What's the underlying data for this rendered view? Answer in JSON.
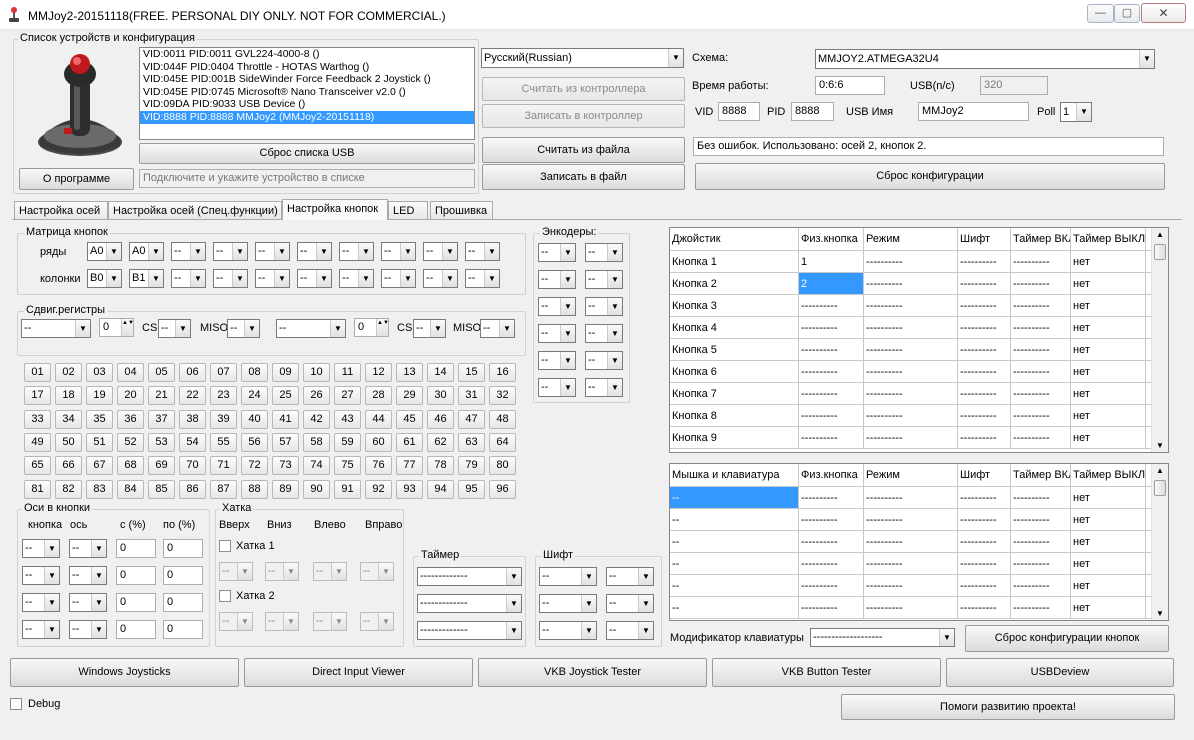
{
  "window": {
    "title": "MMJoy2-20151118(FREE. PERSONAL DIY ONLY. NOT FOR COMMERCIAL.)",
    "min": "—",
    "max": "▢",
    "close": "✕"
  },
  "devices": {
    "group": "Список устройств и конфигурация",
    "items": [
      "VID:0011 PID:0011 GVL224-4000-8 ()",
      "VID:044F PID:0404 Throttle - HOTAS Warthog ()",
      "VID:045E PID:001B SideWinder Force Feedback 2 Joystick ()",
      "VID:045E PID:0745 Microsoft® Nano Transceiver v2.0 ()",
      "VID:09DA PID:9033 USB Device ()",
      "VID:8888 PID:8888 MMJoy2 (MMJoy2-20151118)"
    ],
    "reset_usb": "Сброс списка USB",
    "about": "О программе",
    "hint": "Подключите и укажите устройство в списке"
  },
  "actions": {
    "language": "Русский(Russian)",
    "read_ctrl": "Считать из контроллера",
    "write_ctrl": "Записать в контроллер",
    "read_file": "Считать из файла",
    "write_file": "Записать в файл"
  },
  "config": {
    "scheme_label": "Схема:",
    "scheme": "MMJOY2.ATMEGA32U4",
    "uptime_label": "Время работы:",
    "uptime": "0:6:6",
    "usb_label": "USB(n/c)",
    "usb_val": "320",
    "vid_label": "VID",
    "vid": "8888",
    "pid_label": "PID",
    "pid": "8888",
    "usbname_label": "USB Имя",
    "usbname": "MMJoy2",
    "poll_label": "Poll",
    "poll": "1",
    "status": "Без ошибок. Использовано: осей  2, кнопок  2.",
    "reset_cfg": "Сброс конфигурации"
  },
  "tabs": [
    "Настройка осей",
    "Настройка осей (Спец.функции)",
    "Настройка кнопок",
    "LED",
    "Прошивка"
  ],
  "matrix": {
    "group": "Матрица кнопок",
    "rows_label": "ряды",
    "cols_label": "колонки",
    "row1": "A0",
    "row2": "A0",
    "col1": "B0",
    "col2": "B1",
    "dash": "--"
  },
  "shift_regs": {
    "group": "Сдвиг.регистры",
    "sel": "--",
    "spin": "0",
    "cs": "CS",
    "miso": "MISO",
    "dash": "--"
  },
  "encoders": {
    "group": "Энкодеры:",
    "dash": "--"
  },
  "buttons": [
    "01",
    "02",
    "03",
    "04",
    "05",
    "06",
    "07",
    "08",
    "09",
    "10",
    "11",
    "12",
    "13",
    "14",
    "15",
    "16",
    "17",
    "18",
    "19",
    "20",
    "21",
    "22",
    "23",
    "24",
    "25",
    "26",
    "27",
    "28",
    "29",
    "30",
    "31",
    "32",
    "33",
    "34",
    "35",
    "36",
    "37",
    "38",
    "39",
    "40",
    "41",
    "42",
    "43",
    "44",
    "45",
    "46",
    "47",
    "48",
    "49",
    "50",
    "51",
    "52",
    "53",
    "54",
    "55",
    "56",
    "57",
    "58",
    "59",
    "60",
    "61",
    "62",
    "63",
    "64",
    "65",
    "66",
    "67",
    "68",
    "69",
    "70",
    "71",
    "72",
    "73",
    "74",
    "75",
    "76",
    "77",
    "78",
    "79",
    "80",
    "81",
    "82",
    "83",
    "84",
    "85",
    "86",
    "87",
    "88",
    "89",
    "90",
    "91",
    "92",
    "93",
    "94",
    "95",
    "96"
  ],
  "axes_buttons": {
    "group": "Оси в кнопки",
    "h_btn": "кнопка",
    "h_axis": "ось",
    "h_from": "с (%)",
    "h_to": "по (%)",
    "dash": "--",
    "zero": "0"
  },
  "hat": {
    "group": "Хатка",
    "up": "Вверх",
    "down": "Вниз",
    "left": "Влево",
    "right": "Вправо",
    "hat1": "Хатка 1",
    "hat2": "Хатка 2",
    "dash": "--"
  },
  "timer": {
    "group": "Таймер",
    "dash": "-------------"
  },
  "shift": {
    "group": "Шифт",
    "dash": "--"
  },
  "joystick_table": {
    "headers": [
      "Джойстик",
      "Физ.кнопка",
      "Режим",
      "Шифт",
      "Таймер ВКЛ",
      "Таймер ВЫКЛ"
    ],
    "rows": [
      [
        "Кнопка 1",
        "1",
        "----------",
        "----------",
        "----------",
        "нет"
      ],
      [
        "Кнопка 2",
        "2",
        "----------",
        "----------",
        "----------",
        "нет"
      ],
      [
        "Кнопка 3",
        "----------",
        "----------",
        "----------",
        "----------",
        "нет"
      ],
      [
        "Кнопка 4",
        "----------",
        "----------",
        "----------",
        "----------",
        "нет"
      ],
      [
        "Кнопка 5",
        "----------",
        "----------",
        "----------",
        "----------",
        "нет"
      ],
      [
        "Кнопка 6",
        "----------",
        "----------",
        "----------",
        "----------",
        "нет"
      ],
      [
        "Кнопка 7",
        "----------",
        "----------",
        "----------",
        "----------",
        "нет"
      ],
      [
        "Кнопка 8",
        "----------",
        "----------",
        "----------",
        "----------",
        "нет"
      ],
      [
        "Кнопка 9",
        "----------",
        "----------",
        "----------",
        "----------",
        "нет"
      ]
    ]
  },
  "mouse_table": {
    "headers": [
      "Мышка и клавиатура",
      "Физ.кнопка",
      "Режим",
      "Шифт",
      "Таймер ВКЛ",
      "Таймер ВЫКЛ"
    ],
    "rows": [
      [
        "--",
        "----------",
        "----------",
        "----------",
        "----------",
        "нет"
      ],
      [
        "--",
        "----------",
        "----------",
        "----------",
        "----------",
        "нет"
      ],
      [
        "--",
        "----------",
        "----------",
        "----------",
        "----------",
        "нет"
      ],
      [
        "--",
        "----------",
        "----------",
        "----------",
        "----------",
        "нет"
      ],
      [
        "--",
        "----------",
        "----------",
        "----------",
        "----------",
        "нет"
      ],
      [
        "--",
        "----------",
        "----------",
        "----------",
        "----------",
        "нет"
      ]
    ]
  },
  "modifier": {
    "label": "Модификатор клавиатуры",
    "value": "-------------------",
    "reset_buttons": "Сброс конфигурации кнопок"
  },
  "bottom": {
    "win_joy": "Windows Joysticks",
    "di_viewer": "Direct Input Viewer",
    "vkb_joy": "VKB Joystick Tester",
    "vkb_btn": "VKB Button Tester",
    "usbdeview": "USBDeview",
    "debug": "Debug",
    "help": "Помоги развитию проекта!"
  }
}
